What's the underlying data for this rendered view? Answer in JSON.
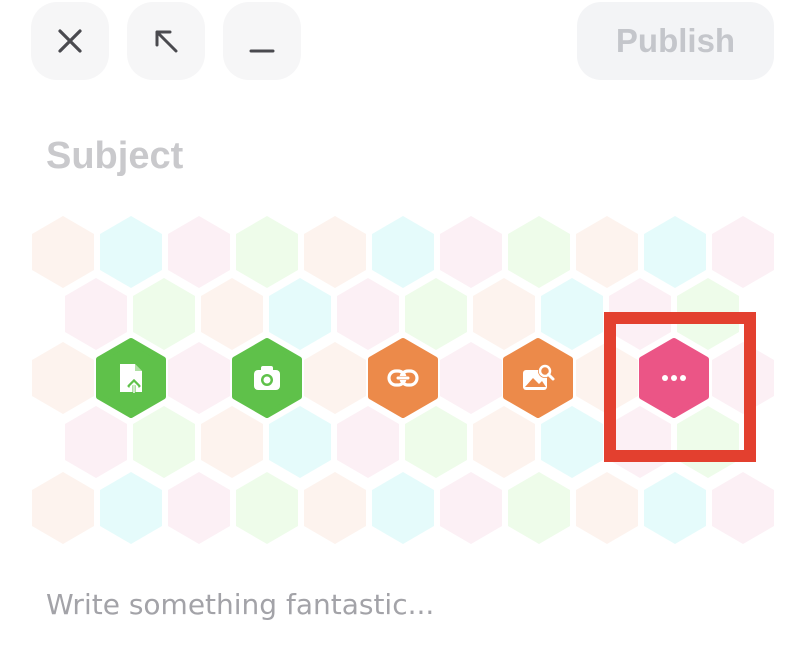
{
  "header": {
    "close": {
      "icon": "close-icon"
    },
    "expand": {
      "icon": "arrow-up-left-icon"
    },
    "minimize": {
      "icon": "minimize-icon"
    },
    "publish_label": "Publish"
  },
  "subject_placeholder": "Subject",
  "body_placeholder": "Write something fantastic...",
  "attachments": [
    {
      "name": "file-upload",
      "icon": "file-upload-icon",
      "color": "#5fc14a"
    },
    {
      "name": "camera",
      "icon": "camera-icon",
      "color": "#5fc14a"
    },
    {
      "name": "link",
      "icon": "link-icon",
      "color": "#ec8a4a"
    },
    {
      "name": "image-search",
      "icon": "image-search-icon",
      "color": "#ec8a4a"
    },
    {
      "name": "more",
      "icon": "more-icon",
      "color": "#eb5586"
    }
  ],
  "palette": {
    "peach": "#fdf3ee",
    "cyan": "#e5fbfb",
    "pink": "#fcf0f5",
    "green": "#eefcea",
    "highlight": "#e3402f"
  }
}
